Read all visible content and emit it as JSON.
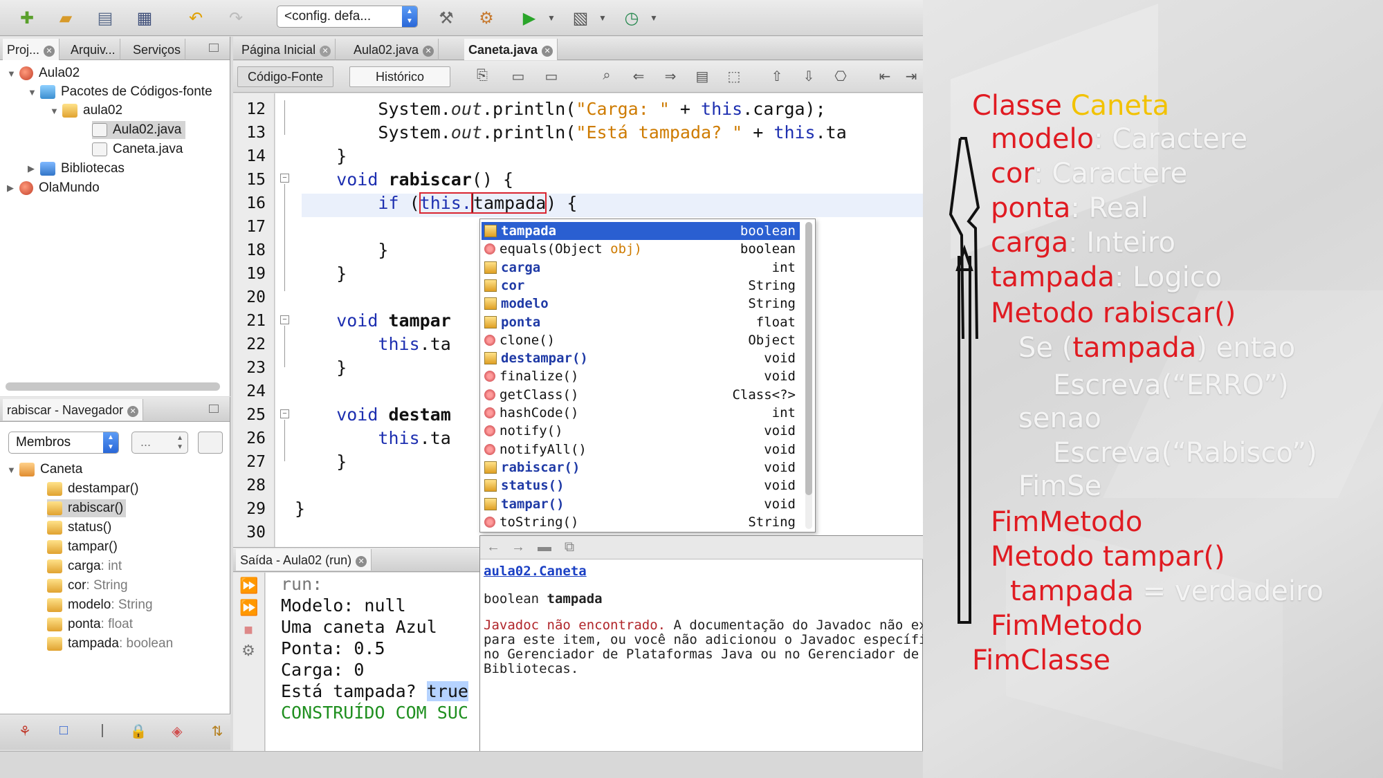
{
  "toolbar": {
    "config": "<config. defa...",
    "icons": [
      "new-file-icon",
      "new-project-icon",
      "open-project-icon",
      "save-all-icon",
      "undo-icon",
      "redo-icon",
      "build-icon",
      "clean-build-icon",
      "run-icon",
      "debug-icon",
      "profile-icon"
    ]
  },
  "projects_panel": {
    "tabs": [
      "Proj...",
      "Arquiv...",
      "Serviços"
    ],
    "tree": [
      {
        "label": "Aula02",
        "level": 0,
        "icon": "project-icon"
      },
      {
        "label": "Pacotes de Códigos-fonte",
        "level": 1,
        "icon": "source-packages-icon"
      },
      {
        "label": "aula02",
        "level": 2,
        "icon": "package-icon"
      },
      {
        "label": "Aula02.java",
        "level": 3,
        "icon": "java-file-icon"
      },
      {
        "label": "Caneta.java",
        "level": 3,
        "icon": "java-file-icon"
      },
      {
        "label": "Bibliotecas",
        "level": 1,
        "icon": "libraries-icon"
      },
      {
        "label": "OlaMundo",
        "level": 0,
        "icon": "project-icon"
      }
    ]
  },
  "navigator": {
    "title": "rabiscar - Navegador",
    "filter": "Membros",
    "filter2": "...",
    "class_name": "Caneta",
    "members": [
      {
        "name": "destampar()",
        "type": ""
      },
      {
        "name": "rabiscar()",
        "type": ""
      },
      {
        "name": "status()",
        "type": ""
      },
      {
        "name": "tampar()",
        "type": ""
      },
      {
        "name": "carga",
        "type": " : int"
      },
      {
        "name": "cor",
        "type": " : String"
      },
      {
        "name": "modelo",
        "type": " : String"
      },
      {
        "name": "ponta",
        "type": " : float"
      },
      {
        "name": "tampada",
        "type": " : boolean"
      }
    ]
  },
  "editor": {
    "tabs": [
      "Página Inicial",
      "Aula02.java",
      "Caneta.java"
    ],
    "view_buttons": [
      "Código-Fonte",
      "Histórico"
    ],
    "line_numbers": [
      "12",
      "13",
      "14",
      "15",
      "16",
      "17",
      "18",
      "19",
      "20",
      "21",
      "22",
      "23",
      "24",
      "25",
      "26",
      "27",
      "28",
      "29",
      "30"
    ],
    "code": {
      "l12_a": "        System.",
      "l12_out": "out",
      "l12_b": ".println(",
      "l12_str": "\"Carga: \"",
      "l12_c": " + ",
      "l12_this": "this",
      "l12_d": ".carga);",
      "l13_a": "        System.",
      "l13_out": "out",
      "l13_b": ".println(",
      "l13_str": "\"Está tampada? \"",
      "l13_c": " + ",
      "l13_this": "this",
      "l13_d": ".ta",
      "l14": "    }",
      "l15_kw": "    void ",
      "l15_name": "rabiscar",
      "l15_rest": "() {",
      "l16_if": "        if ",
      "l16_p": "(",
      "l16_this": "this.",
      "l16_field": "tampada",
      "l16_rest": ") {",
      "l18": "        }",
      "l19": "    }",
      "l21_kw": "    void ",
      "l21_name": "tampar",
      "l22_a": "        ",
      "l22_this": "this",
      "l22_b": ".ta",
      "l23": "    }",
      "l25_kw": "    void ",
      "l25_name": "destam",
      "l26_a": "        ",
      "l26_this": "this",
      "l26_b": ".ta",
      "l27": "    }",
      "l29": "}"
    }
  },
  "completion": {
    "items": [
      {
        "name": "tampada",
        "param": "",
        "type": "boolean",
        "kind": "field",
        "bold": true
      },
      {
        "name": "equals(Object ",
        "param": "obj)",
        "type": "boolean",
        "kind": "method",
        "bold": false
      },
      {
        "name": "carga",
        "param": "",
        "type": "int",
        "kind": "field",
        "bold": true
      },
      {
        "name": "cor",
        "param": "",
        "type": "String",
        "kind": "field",
        "bold": true
      },
      {
        "name": "modelo",
        "param": "",
        "type": "String",
        "kind": "field",
        "bold": true
      },
      {
        "name": "ponta",
        "param": "",
        "type": "float",
        "kind": "field",
        "bold": true
      },
      {
        "name": "clone()",
        "param": "",
        "type": "Object",
        "kind": "method",
        "bold": false
      },
      {
        "name": "destampar()",
        "param": "",
        "type": "void",
        "kind": "cls",
        "bold": true
      },
      {
        "name": "finalize()",
        "param": "",
        "type": "void",
        "kind": "method",
        "bold": false
      },
      {
        "name": "getClass()",
        "param": "",
        "type": "Class<?>",
        "kind": "method",
        "bold": false
      },
      {
        "name": "hashCode()",
        "param": "",
        "type": "int",
        "kind": "method",
        "bold": false
      },
      {
        "name": "notify()",
        "param": "",
        "type": "void",
        "kind": "method",
        "bold": false
      },
      {
        "name": "notifyAll()",
        "param": "",
        "type": "void",
        "kind": "method",
        "bold": false
      },
      {
        "name": "rabiscar()",
        "param": "",
        "type": "void",
        "kind": "cls",
        "bold": true
      },
      {
        "name": "status()",
        "param": "",
        "type": "void",
        "kind": "cls",
        "bold": true
      },
      {
        "name": "tampar()",
        "param": "",
        "type": "void",
        "kind": "cls",
        "bold": true
      },
      {
        "name": "toString()",
        "param": "",
        "type": "String",
        "kind": "method",
        "bold": false
      }
    ]
  },
  "javadoc": {
    "link": "aula02.Caneta",
    "sig_type": "boolean ",
    "sig_name": "tampada",
    "line1_red": "Javadoc não encontrado.",
    "line1_rest": " A documentação do Javadoc não existe",
    "line2": "para este item, ou você não adicionou o Javadoc específico",
    "line3": "no Gerenciador de Plataformas Java ou no Gerenciador de",
    "line4": "Bibliotecas."
  },
  "output": {
    "tab": "Saída - Aula02 (run)",
    "lines": [
      "run:",
      "Modelo: null",
      "Uma caneta Azul",
      "Ponta: 0.5",
      "Carga: 0"
    ],
    "tampada_label": "Está tampada? ",
    "tampada_value": "true",
    "build": "CONSTRUÍDO COM SUC"
  },
  "pseudocode": {
    "class_kw": "Classe ",
    "class_name": "Caneta",
    "attrs": [
      {
        "name": "modelo",
        "type": ": Caractere"
      },
      {
        "name": "cor",
        "type": ": Caractere"
      },
      {
        "name": "ponta",
        "type": ": Real"
      },
      {
        "name": "carga",
        "type": ": Inteiro"
      },
      {
        "name": "tampada",
        "type": ": Logico"
      }
    ],
    "m1_kw": "Metodo ",
    "m1_name": "rabiscar()",
    "se_a": "Se (",
    "se_var": "tampada",
    "se_b": ") entao",
    "esc1": "Escreva(“ERRO”)",
    "senao": "senao",
    "esc2": "Escreva(“Rabisco”)",
    "fimse": "FimSe",
    "fim1": "FimMetodo",
    "m2_kw": "Metodo ",
    "m2_name": "tampar()",
    "assign_var": "tampada",
    "assign_rest": " = verdadeiro",
    "fim2": "FimMetodo",
    "fimclasse": "FimClasse",
    "colors": {
      "red": "#e01b22",
      "yellow": "#f2c200",
      "white": "#f4f4f4"
    }
  }
}
